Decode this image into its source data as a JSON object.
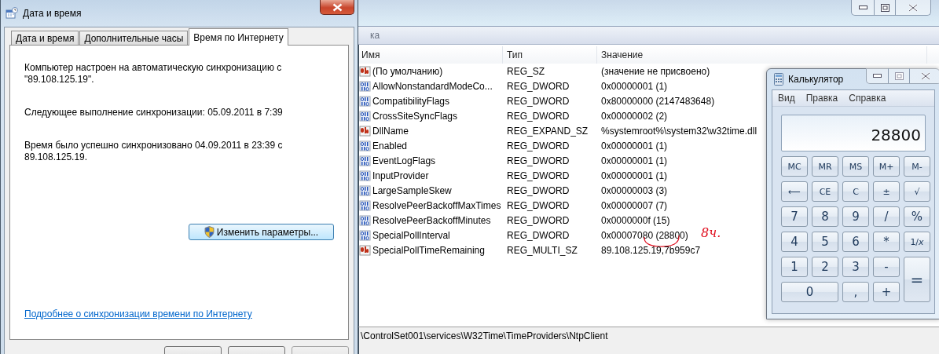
{
  "registry_editor": {
    "menu_fragment": "ка",
    "columns": [
      "Имя",
      "Тип",
      "Значение"
    ],
    "rows": [
      {
        "kind": "string",
        "name": "(По умолчанию)",
        "type": "REG_SZ",
        "value": "(значение не присвоено)",
        "circled": false
      },
      {
        "kind": "binary",
        "name": "AllowNonstandardModeCo...",
        "type": "REG_DWORD",
        "value": "0x00000001 (1)",
        "circled": false
      },
      {
        "kind": "binary",
        "name": "CompatibilityFlags",
        "type": "REG_DWORD",
        "value": "0x80000000 (2147483648)",
        "circled": false
      },
      {
        "kind": "binary",
        "name": "CrossSiteSyncFlags",
        "type": "REG_DWORD",
        "value": "0x00000002 (2)",
        "circled": false
      },
      {
        "kind": "string",
        "name": "DllName",
        "type": "REG_EXPAND_SZ",
        "value": "%systemroot%\\system32\\w32time.dll",
        "circled": false
      },
      {
        "kind": "binary",
        "name": "Enabled",
        "type": "REG_DWORD",
        "value": "0x00000001 (1)",
        "circled": false
      },
      {
        "kind": "binary",
        "name": "EventLogFlags",
        "type": "REG_DWORD",
        "value": "0x00000001 (1)",
        "circled": false
      },
      {
        "kind": "binary",
        "name": "InputProvider",
        "type": "REG_DWORD",
        "value": "0x00000001 (1)",
        "circled": false
      },
      {
        "kind": "binary",
        "name": "LargeSampleSkew",
        "type": "REG_DWORD",
        "value": "0x00000003 (3)",
        "circled": false
      },
      {
        "kind": "binary",
        "name": "ResolvePeerBackoffMaxTimes",
        "type": "REG_DWORD",
        "value": "0x00000007 (7)",
        "circled": false
      },
      {
        "kind": "binary",
        "name": "ResolvePeerBackoffMinutes",
        "type": "REG_DWORD",
        "value": "0x0000000f (15)",
        "circled": false
      },
      {
        "kind": "binary",
        "name": "SpecialPollInterval",
        "type": "REG_DWORD",
        "value": "0x00007080 (28800)",
        "circled": true,
        "note": "8ч."
      },
      {
        "kind": "string",
        "name": "SpecialPollTimeRemaining",
        "type": "REG_MULTI_SZ",
        "value": "89.108.125.19,7b959c7",
        "circled": false
      }
    ],
    "status_path": "\\ControlSet001\\services\\W32Time\\TimeProviders\\NtpClient"
  },
  "datetime_dialog": {
    "title": "Дата и время",
    "tabs": [
      {
        "label": "Дата и время",
        "selected": false
      },
      {
        "label": "Дополнительные часы",
        "selected": false
      },
      {
        "label": "Время по Интернету",
        "selected": true
      }
    ],
    "paragraphs": [
      "Компьютер настроен на автоматическую синхронизацию с \"89.108.125.19\".",
      "Следующее выполнение синхронизации: 05.09.2011 в 7:39",
      "Время было успешно синхронизовано 04.09.2011 в 23:39 с 89.108.125.19."
    ],
    "change_button": "Изменить параметры...",
    "help_link": "Подробнее о синхронизации времени по Интернету"
  },
  "calculator": {
    "title": "Калькулятор",
    "menu": [
      "Вид",
      "Правка",
      "Справка"
    ],
    "display": "28800",
    "keys": [
      {
        "label": "MC",
        "kind": "normal"
      },
      {
        "label": "MR",
        "kind": "normal"
      },
      {
        "label": "MS",
        "kind": "normal"
      },
      {
        "label": "M+",
        "kind": "normal"
      },
      {
        "label": "M-",
        "kind": "normal"
      },
      {
        "label": "⟵",
        "kind": "normal"
      },
      {
        "label": "CE",
        "kind": "normal"
      },
      {
        "label": "C",
        "kind": "normal"
      },
      {
        "label": "±",
        "kind": "normal"
      },
      {
        "label": "√",
        "kind": "normal"
      },
      {
        "label": "7",
        "kind": "normal"
      },
      {
        "label": "8",
        "kind": "normal"
      },
      {
        "label": "9",
        "kind": "normal"
      },
      {
        "label": "/",
        "kind": "normal"
      },
      {
        "label": "%",
        "kind": "normal"
      },
      {
        "label": "4",
        "kind": "normal"
      },
      {
        "label": "5",
        "kind": "normal"
      },
      {
        "label": "6",
        "kind": "normal"
      },
      {
        "label": "*",
        "kind": "normal"
      },
      {
        "label": "1/*x*",
        "kind": "normal"
      },
      {
        "label": "1",
        "kind": "normal"
      },
      {
        "label": "2",
        "kind": "normal"
      },
      {
        "label": "3",
        "kind": "normal"
      },
      {
        "label": "-",
        "kind": "normal"
      },
      {
        "label": "=",
        "kind": "tall"
      },
      {
        "label": "0",
        "kind": "wide"
      },
      {
        "label": ",",
        "kind": "normal"
      },
      {
        "label": "+",
        "kind": "normal"
      }
    ]
  }
}
